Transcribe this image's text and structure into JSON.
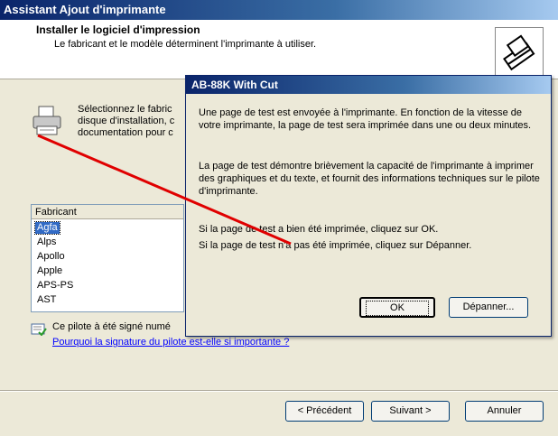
{
  "wizard": {
    "title": "Assistant Ajout d'imprimante",
    "header_title": "Installer le logiciel d'impression",
    "header_subtitle": "Le fabricant et le modèle déterminent l'imprimante à utiliser.",
    "intro_text": "Sélectionnez le fabric\ndisque d'installation, c\ndocumentation pour c",
    "manufacturer_header": "Fabricant",
    "manufacturers": [
      "Agfa",
      "Alps",
      "Apollo",
      "Apple",
      "APS-PS",
      "AST"
    ],
    "selected_manufacturer": "Agfa",
    "signed_text": "Ce pilote à été signé numé",
    "signed_link": "Pourquoi la signature du pilote est-elle si importante ?",
    "buttons": {
      "back": "< Précédent",
      "next": "Suivant >",
      "cancel": "Annuler"
    }
  },
  "dialog": {
    "title": "AB-88K With Cut",
    "paragraph1": "Une page de test est envoyée à l'imprimante. En fonction de la vitesse de votre imprimante, la page de test sera imprimée dans une ou deux minutes.",
    "paragraph2": "La page de test démontre brièvement la capacité de l'imprimante à imprimer des graphiques et du texte, et fournit des informations techniques sur le pilote d'imprimante.",
    "paragraph3": "Si la page de test a bien été imprimée, cliquez sur OK.",
    "paragraph4": "Si la page de test n'a pas été imprimée, cliquez sur Dépanner.",
    "ok_label": "OK",
    "troubleshoot_label": "Dépanner..."
  },
  "annotation_color": "#e00000"
}
